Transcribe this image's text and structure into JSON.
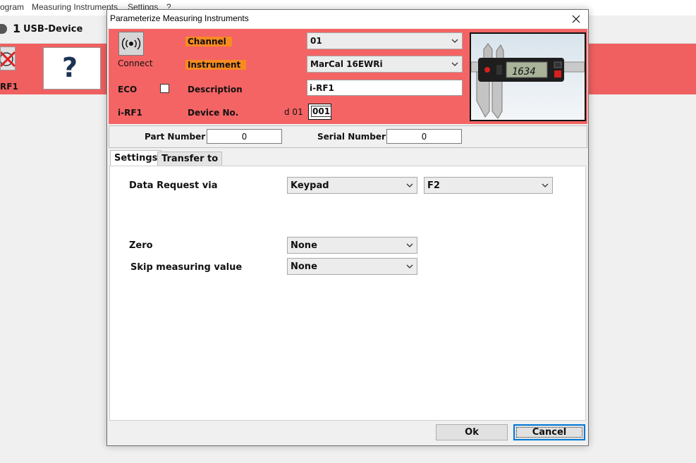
{
  "app": {
    "menu": [
      "ogram",
      "Measuring Instruments",
      "Settings",
      "?"
    ],
    "device_num": "1",
    "device_label": "USB-Device",
    "device_short": "RF1",
    "question_mark": "?"
  },
  "dialog": {
    "title": "Parameterize Measuring Instruments",
    "connect_label": "Connect",
    "eco_label": "ECO",
    "eco_checked": false,
    "device_id": "i-RF1",
    "channel_label": "Channel",
    "instrument_label": "Instrument",
    "description_label": "Description",
    "device_no_label": "Device No.",
    "channel_value": "01",
    "instrument_value": "MarCal 16EWRi",
    "description_value": "i-RF1",
    "device_no_prefix": "d  01",
    "device_no_value": "001",
    "caliper_display": "1634",
    "part_number_label": "Part Number",
    "part_number_value": "0",
    "serial_number_label": "Serial Number",
    "serial_number_value": "0",
    "tabs": [
      {
        "label": "Settings",
        "active": true
      },
      {
        "label": "Transfer to",
        "active": false
      }
    ],
    "settings": {
      "data_request_label": "Data Request via",
      "data_request_value": "Keypad",
      "data_request_key": "F2",
      "zero_label": "Zero",
      "zero_value": "None",
      "skip_label": "Skip measuring value",
      "skip_value": "None"
    },
    "ok_label": "Ok",
    "cancel_label": "Cancel"
  },
  "colors": {
    "header_red": "#f46464",
    "highlight_orange": "#f88a22",
    "default_button_border": "#0078d7"
  }
}
